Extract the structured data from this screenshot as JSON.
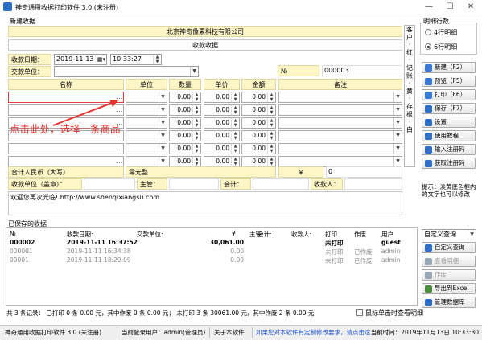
{
  "window": {
    "title": "神奇通用收据打印软件 3.0 (未注册)",
    "minimize": "—",
    "maximize": "☐",
    "close": "✕"
  },
  "new_receipt": {
    "group_title": "新建收据",
    "company": "北京神奇像素科技有限公司",
    "receipt_title": "收款收据",
    "date_label": "收款日期：",
    "date_value": "2019-11-13",
    "time_value": "10:33:27",
    "payer_label": "交款单位：",
    "payer_value": "",
    "no_label": "№",
    "no_value": "000003",
    "columns": [
      "名称",
      "单位",
      "数量",
      "单价",
      "金额",
      "备注"
    ],
    "item_rows": [
      {
        "qty": "0.00",
        "price": "0.00",
        "amount": "0.00",
        "ellipsis": "..."
      },
      {
        "qty": "0.00",
        "price": "0.00",
        "amount": "0.00",
        "ellipsis": "..."
      },
      {
        "qty": "0.00",
        "price": "0.00",
        "amount": "0.00",
        "ellipsis": "..."
      },
      {
        "qty": "0.00",
        "price": "0.00",
        "amount": "0.00",
        "ellipsis": "..."
      },
      {
        "qty": "0.00",
        "price": "0.00",
        "amount": "0.00",
        "ellipsis": "..."
      },
      {
        "qty": "0.00",
        "price": "0.00",
        "amount": "0.00",
        "ellipsis": "..."
      }
    ],
    "annotation": "点击此处，选择一条商品",
    "total_label": "合计人民币（大写）",
    "total_cn": "零元整",
    "yen_label": "￥",
    "total_num": "0",
    "unit_label": "收款单位（盖章）：",
    "supervisor_label": "主管：",
    "accountant_label": "会计：",
    "collector_label": "收款人：",
    "message": "欢迎您再次光临! http://www.shenqixiangsu.com",
    "side_text": [
      "客",
      "户",
      "·",
      "红",
      "·",
      "记",
      "账",
      "·",
      "黄",
      "·",
      "存",
      "根",
      "·",
      "白"
    ]
  },
  "sidebar": {
    "rows_title": "明细行数",
    "option_4": "4行明细",
    "option_6": "6行明细",
    "selected": "6行明细",
    "buttons": [
      {
        "label": "新建（F2）",
        "icon": "new-doc-icon",
        "color": "#3a7bd5"
      },
      {
        "label": "预览（F5）",
        "icon": "preview-icon",
        "color": "#3a7bd5"
      },
      {
        "label": "打印（F6）",
        "icon": "printer-icon",
        "color": "#3a7bd5"
      },
      {
        "label": "保存（F7）",
        "icon": "save-icon",
        "color": "#2f6fc8"
      },
      {
        "label": "设置",
        "icon": "gear-icon",
        "color": "#2f6fc8"
      },
      {
        "label": "使用教程",
        "icon": "tutorial-icon",
        "color": "#2f6fc8"
      },
      {
        "label": "输入注册码",
        "icon": "key-icon",
        "color": "#2f6fc8"
      },
      {
        "label": "获取注册码",
        "icon": "get-code-icon",
        "color": "#2f6fc8"
      }
    ],
    "hint": "提示：淡黄底色框内的文字也可以修改"
  },
  "saved": {
    "group_title": "已保存的收据",
    "columns": [
      "№",
      "收款日期:",
      "交款单位:",
      "¥",
      "主管:",
      "会计:",
      "收款人:",
      "打印",
      "作废",
      "用户"
    ],
    "rows": [
      {
        "no": "000002",
        "date": "2019-11-11 16:37:52",
        "payer": "",
        "amount": "30,061.00",
        "supervisor": "",
        "accountant": "",
        "collector": "",
        "print": "未打印",
        "void": "",
        "user": "guest",
        "style": "bold"
      },
      {
        "no": "000001",
        "date": "2019-11-11 16:34:38",
        "payer": "",
        "amount": "0.00",
        "supervisor": "",
        "accountant": "",
        "collector": "",
        "print": "未打印",
        "void": "已作废",
        "user": "admin",
        "style": "gray"
      },
      {
        "no": "00001",
        "date": "2019-11-11 18:29:09",
        "payer": "",
        "amount": "0.00",
        "supervisor": "",
        "accountant": "",
        "collector": "",
        "print": "未打印",
        "void": "已作废",
        "user": "admin",
        "style": "gray"
      }
    ],
    "query_select": "自定义查询",
    "buttons": [
      {
        "label": "自定义查询",
        "icon": "search-icon",
        "enabled": true
      },
      {
        "label": "查看明细",
        "icon": "view-detail-icon",
        "enabled": false
      },
      {
        "label": "作废",
        "icon": "void-icon",
        "enabled": false
      },
      {
        "label": "导出到Excel",
        "icon": "excel-icon",
        "enabled": true
      },
      {
        "label": "管理数据库",
        "icon": "database-icon",
        "enabled": true
      }
    ],
    "summary": "共 3 条记录： 已打印 0 条 0.00 元，其中作废 0 条 0.00 元； 未打印 3 条 30061.00 元，其中作废 2 条 0.00 元",
    "checkbox_label": "鼠标单击时查看明细"
  },
  "statusbar": {
    "app": "神奇通用收据打印软件 3.0 (未注册)",
    "user": "当前登录用户：admin(管理员)",
    "about": "关于本软件",
    "custom_link": "如果您对本软件有定制修改要求，请点击这里联系我们",
    "time": "当前时间：2019年11月13日 10:33:30"
  }
}
